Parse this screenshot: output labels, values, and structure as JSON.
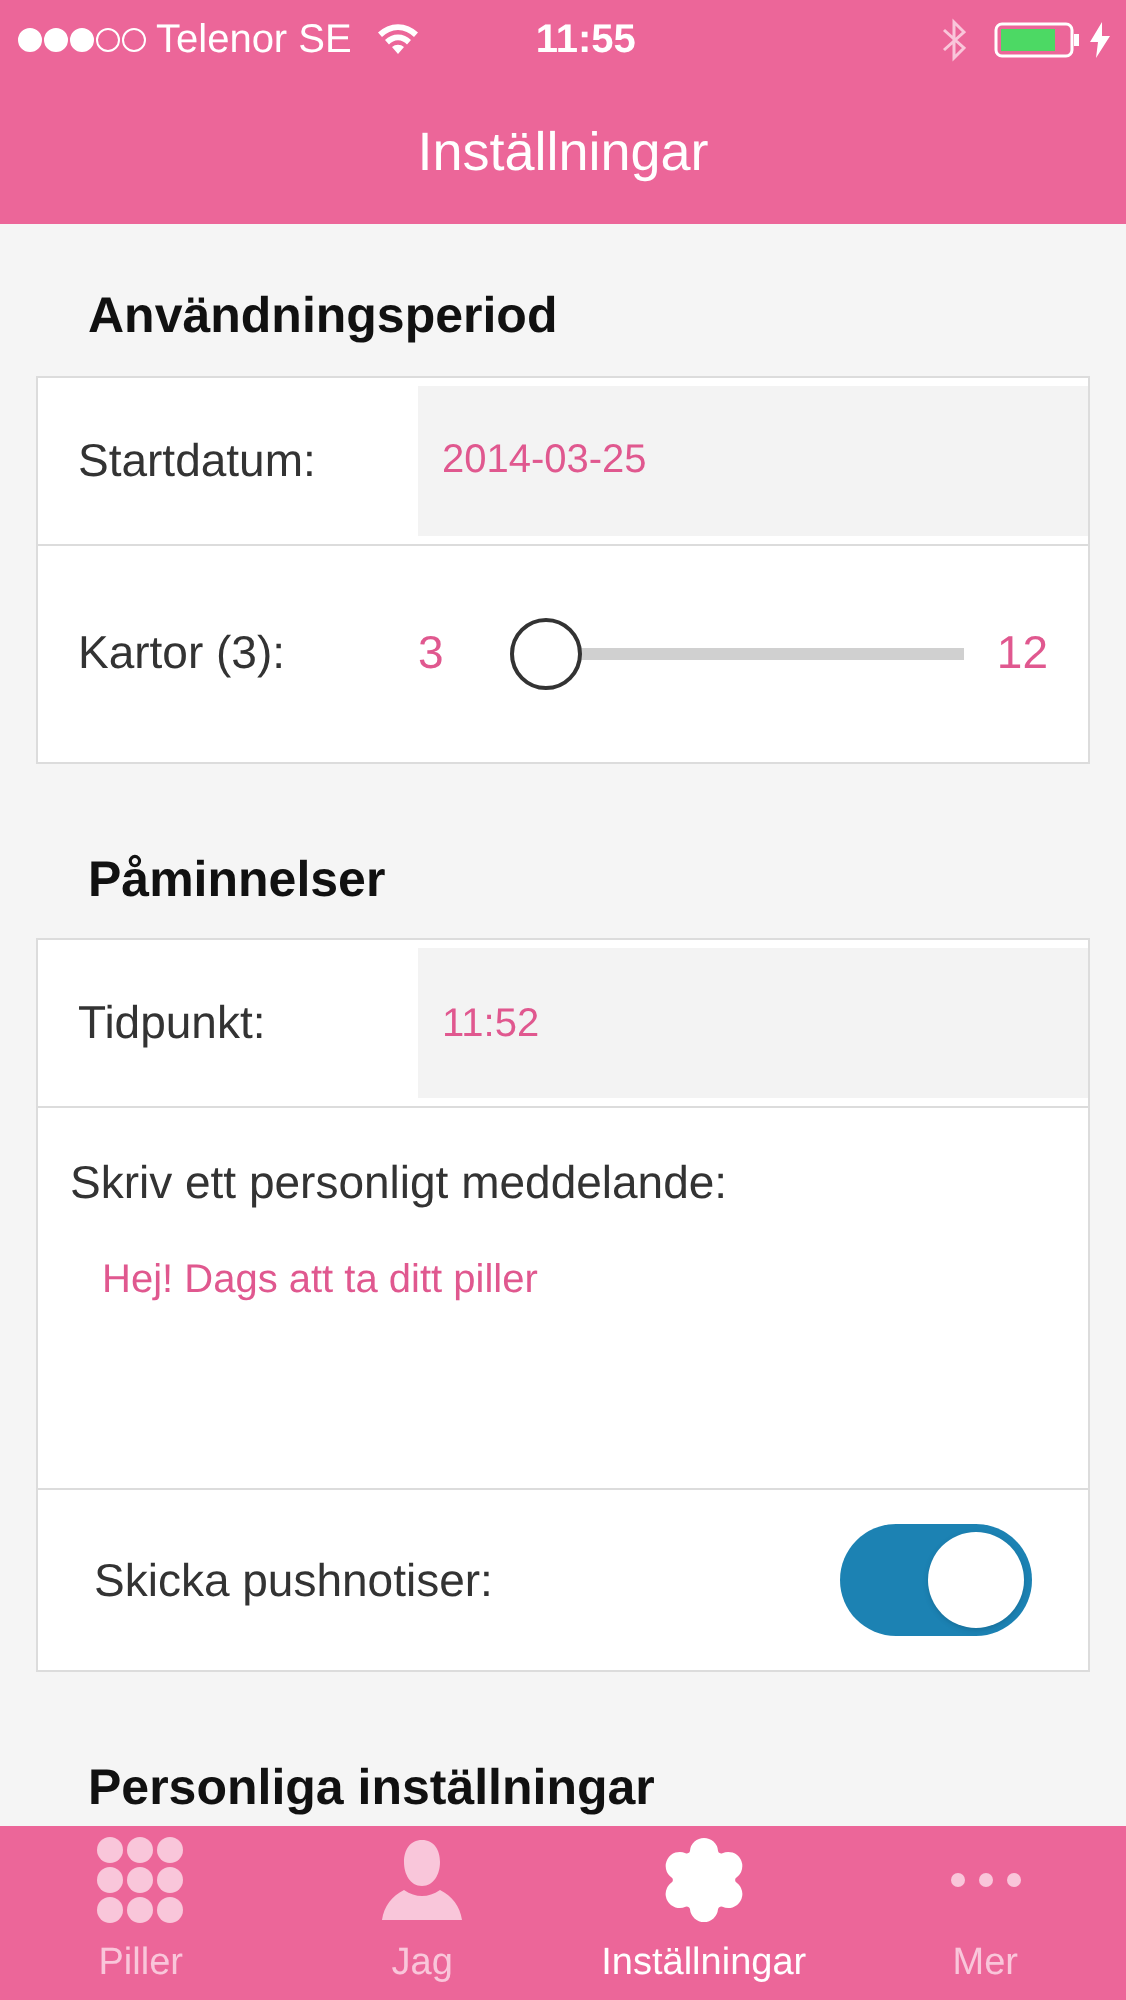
{
  "status_bar": {
    "carrier": "Telenor SE",
    "time": "11:55"
  },
  "nav_bar": {
    "title": "Inställningar"
  },
  "sections": [
    {
      "title": "Användningsperiod",
      "rows": [
        {
          "kind": "field",
          "label": "Startdatum:",
          "value": "2014-03-25"
        },
        {
          "kind": "slider",
          "label": "Kartor (3):",
          "min": "3",
          "max": "12",
          "level": 0
        }
      ]
    },
    {
      "title": "Påminnelser",
      "rows": [
        {
          "kind": "field",
          "label": "Tidpunkt:",
          "value": "11:52"
        },
        {
          "kind": "message",
          "label": "Skriv ett personligt meddelande:",
          "value": "Hej! Dags att ta ditt piller"
        },
        {
          "kind": "toggle",
          "label": "Skicka pushnotiser:",
          "on": true
        }
      ]
    },
    {
      "title": "Personliga inställningar"
    }
  ],
  "tab_bar": [
    {
      "label": "Piller",
      "selected": false
    },
    {
      "label": "Jag",
      "selected": false
    },
    {
      "label": "Inställningar",
      "selected": true
    },
    {
      "label": "Mer",
      "selected": false
    }
  ]
}
